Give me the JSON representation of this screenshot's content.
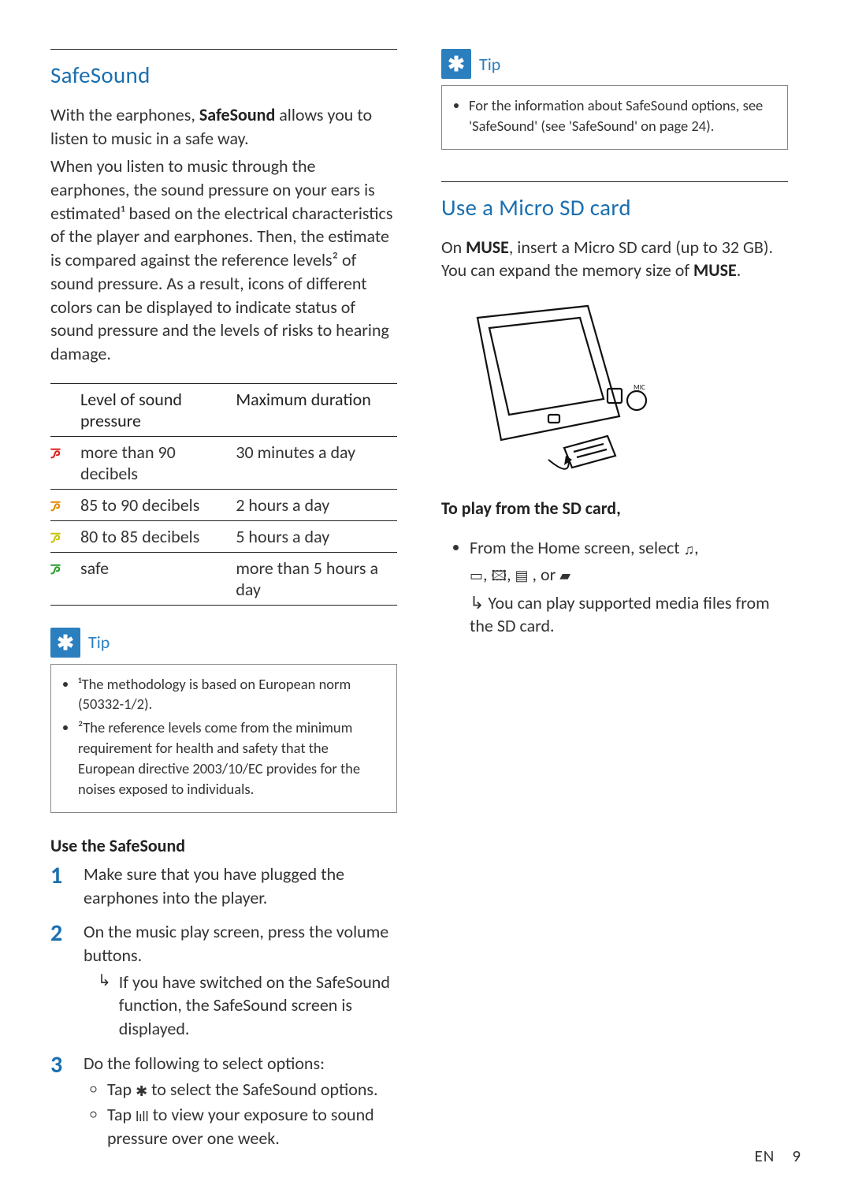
{
  "left": {
    "heading": "SafeSound",
    "intro_prefix": "With the earphones, ",
    "intro_bold": "SafeSound",
    "intro_suffix": " allows you to listen to music in a safe way.",
    "para2": "When you listen to music through the earphones, the sound pressure on your ears is estimated¹ based on the electrical characteristics of the player and earphones. Then, the estimate is compared against the reference levels² of sound pressure. As a result, icons of different colors can be displayed to indicate status of sound pressure and the levels of risks to hearing damage.",
    "table": {
      "col1": "Level of sound pressure",
      "col2": "Maximum duration",
      "rows": [
        {
          "level": "more than 90 decibels",
          "dur": "30 minutes a day"
        },
        {
          "level": "85 to 90 decibels",
          "dur": "2 hours a day"
        },
        {
          "level": "80 to 85 decibels",
          "dur": "5 hours a day"
        },
        {
          "level": "safe",
          "dur": "more than 5 hours a day"
        }
      ]
    },
    "tip_label": "Tip",
    "tip1": "¹The methodology is based on European norm (50332-1/2).",
    "tip2": "²The reference levels come from the minimum requirement for health and safety that the European directive 2003/10/EC provides for the noises exposed to individuals.",
    "use_heading": "Use the SafeSound",
    "step1": "Make sure that you have plugged the earphones into the player.",
    "step2": "On the music play screen, press the volume buttons.",
    "step2_arrow_a": "If you have switched on the ",
    "step2_arrow_b": "SafeSound",
    "step2_arrow_c": " function, the ",
    "step2_arrow_d": "SafeSound",
    "step2_arrow_e": " screen is displayed.",
    "step3": "Do the following to select options:",
    "step3_b1_a": "Tap ",
    "step3_b1_b": " to select the ",
    "step3_b1_c": "SafeSound",
    "step3_b1_d": " options.",
    "step3_b2_a": "Tap ",
    "step3_b2_b": " to view your exposure to sound pressure over one week."
  },
  "right": {
    "tip_label": "Tip",
    "tip_text": "For the information about SafeSound options, see 'SafeSound' (see 'SafeSound' on page 24).",
    "heading": "Use a Micro SD card",
    "p_a": "On ",
    "p_b": "MUSE",
    "p_c": ", insert a Micro SD card (up to 32 GB). You can expand the memory size of ",
    "p_d": "MUSE",
    "p_e": ".",
    "play_heading": "To play from the SD card,",
    "play_b1_a": "From the Home screen, select ",
    "play_b1_b": ",",
    "play_line2": ", or ",
    "play_arrow": "You can play supported media files from the SD card."
  },
  "footer": {
    "lang": "EN",
    "page": "9"
  }
}
